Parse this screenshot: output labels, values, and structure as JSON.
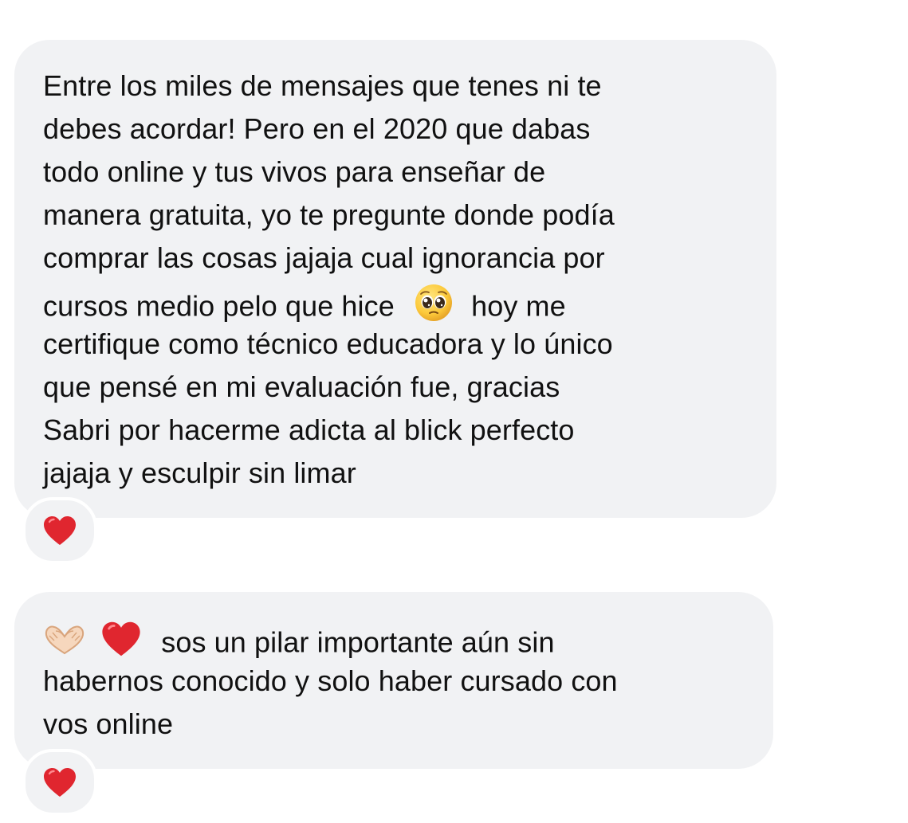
{
  "messages": [
    {
      "lines": [
        "Entre los miles de mensajes que tenes ni te",
        "debes acordar! Pero en el 2020 que dabas",
        "todo online y tus vivos para enseñar de",
        "manera gratuita, yo te pregunte donde podía",
        "comprar las cosas jajaja cual ignorancia por",
        "cursos medio pelo que hice",
        "hoy me",
        "certifique como técnico educadora y lo único",
        "que pensé en mi evaluación fue, gracias",
        "Sabri por hacerme adicta al blick perfecto",
        "jajaja y esculpir sin limar"
      ],
      "inline_emoji": "pleading-face",
      "reaction": "red-heart"
    },
    {
      "lines": [
        "sos un pilar importante aún sin",
        "habernos conocido y solo haber cursado con",
        "vos online"
      ],
      "leading_emojis": [
        "heart-hands",
        "red-heart"
      ],
      "reaction": "red-heart"
    }
  ],
  "colors": {
    "bubble": "#f1f2f4",
    "text": "#111111",
    "heart": "#e0262f"
  }
}
